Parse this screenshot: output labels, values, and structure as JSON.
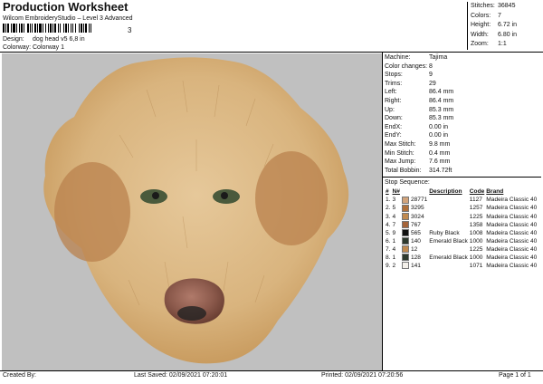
{
  "header": {
    "title": "Production Worksheet",
    "subtitle": "Wilcom EmbroideryStudio – Level 3 Advanced",
    "barcode_suffix": "3",
    "design_label": "Design:",
    "design_value": "dog head v5 6,8 in",
    "colorway_label": "Colorway:",
    "colorway_value": "Colorway 1"
  },
  "stats": [
    {
      "label": "Stitches:",
      "value": "36845"
    },
    {
      "label": "Colors:",
      "value": "7"
    },
    {
      "label": "Height:",
      "value": "6.72 in"
    },
    {
      "label": "Width:",
      "value": "6.80 in"
    },
    {
      "label": "Zoom:",
      "value": "1:1"
    }
  ],
  "machine": [
    {
      "label": "Machine:",
      "value": "Tajima"
    },
    {
      "label": "Color changes:",
      "value": "8"
    },
    {
      "label": "Stops:",
      "value": "9"
    },
    {
      "label": "Trims:",
      "value": "29"
    },
    {
      "label": "Left:",
      "value": "86.4 mm"
    },
    {
      "label": "Right:",
      "value": "86.4 mm"
    },
    {
      "label": "Up:",
      "value": "85.3 mm"
    },
    {
      "label": "Down:",
      "value": "85.3 mm"
    },
    {
      "label": "EndX:",
      "value": "0.00 in"
    },
    {
      "label": "EndY:",
      "value": "0.00 in"
    },
    {
      "label": "Max Stitch:",
      "value": "9.8 mm"
    },
    {
      "label": "Min Stitch:",
      "value": "0.4 mm"
    },
    {
      "label": "Max Jump:",
      "value": "7.6 mm"
    },
    {
      "label": "Total Bobbin:",
      "value": "314.72ft"
    }
  ],
  "stop_sequence": {
    "title": "Stop Sequence:",
    "headers": {
      "num": "#",
      "n": "N#",
      "swatch": "",
      "sym": "",
      "desc": "Description",
      "code": "Code",
      "brand": "Brand"
    },
    "rows": [
      {
        "num": "1.",
        "n": "3",
        "color": "#d2a47c",
        "sym": "28771",
        "desc": "",
        "code": "1127",
        "brand": "Madeira Classic 40"
      },
      {
        "num": "2.",
        "n": "5",
        "color": "#b0703a",
        "sym": "3295",
        "desc": "",
        "code": "1257",
        "brand": "Madeira Classic 40"
      },
      {
        "num": "3.",
        "n": "4",
        "color": "#c08a50",
        "sym": "3024",
        "desc": "",
        "code": "1225",
        "brand": "Madeira Classic 40"
      },
      {
        "num": "4.",
        "n": "7",
        "color": "#a5643a",
        "sym": "767",
        "desc": "",
        "code": "1358",
        "brand": "Madeira Classic 40"
      },
      {
        "num": "5.",
        "n": "9",
        "color": "#111111",
        "sym": "565",
        "desc": "Ruby Black",
        "code": "1008",
        "brand": "Madeira Classic 40"
      },
      {
        "num": "6.",
        "n": "1",
        "color": "#2e3a2e",
        "sym": "140",
        "desc": "Emerald Black",
        "code": "1000",
        "brand": "Madeira Classic 40"
      },
      {
        "num": "7.",
        "n": "4",
        "color": "#c08a50",
        "sym": "12",
        "desc": "",
        "code": "1225",
        "brand": "Madeira Classic 40"
      },
      {
        "num": "8.",
        "n": "1",
        "color": "#2e3a2e",
        "sym": "128",
        "desc": "Emerald Black",
        "code": "1000",
        "brand": "Madeira Classic 40"
      },
      {
        "num": "9.",
        "n": "2",
        "color": "#f4f0ea",
        "sym": "141",
        "desc": "",
        "code": "1071",
        "brand": "Madeira Classic 40"
      }
    ]
  },
  "footer": {
    "created_by": "Created By:",
    "last_saved": "Last Saved: 02/09/2021 07:20:01",
    "printed": "Printed: 02/09/2021 07:20:56",
    "page": "Page 1 of 1"
  },
  "colors": {
    "canvas_bg": "#c0c0c0"
  }
}
